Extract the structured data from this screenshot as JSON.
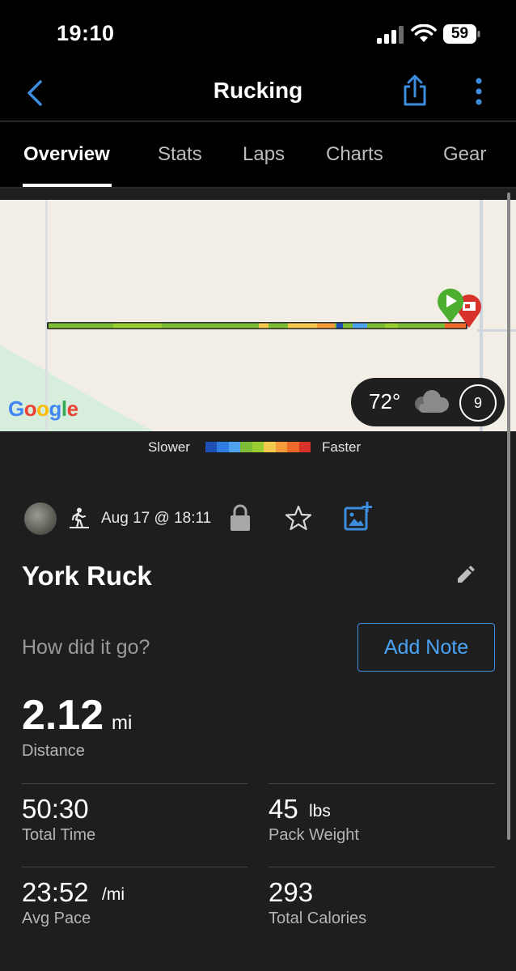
{
  "status_bar": {
    "time": "19:10",
    "battery": "59"
  },
  "nav": {
    "title": "Rucking"
  },
  "tabs": [
    {
      "label": "Overview"
    },
    {
      "label": "Stats"
    },
    {
      "label": "Laps"
    },
    {
      "label": "Charts"
    },
    {
      "label": "Gear"
    }
  ],
  "map": {
    "attribution": "Google",
    "weather": {
      "temp": "72°",
      "wind": "9"
    }
  },
  "legend": {
    "slower": "Slower",
    "faster": "Faster",
    "colors": [
      "#1e4fb5",
      "#2f7de0",
      "#4fa3ee",
      "#7dbd35",
      "#9acd32",
      "#f2c94c",
      "#f59b3a",
      "#ee6a2a",
      "#d9322a"
    ]
  },
  "activity": {
    "date": "Aug 17 @ 18:11",
    "name": "York Ruck",
    "prompt": "How did it go?",
    "add_note": "Add Note"
  },
  "stats": {
    "distance": {
      "value": "2.12",
      "unit": "mi",
      "label": "Distance"
    },
    "total_time": {
      "value": "50:30",
      "label": "Total Time"
    },
    "pack_weight": {
      "value": "45",
      "unit": "lbs",
      "label": "Pack Weight"
    },
    "avg_pace": {
      "value": "23:52",
      "unit": "/mi",
      "label": "Avg Pace"
    },
    "calories": {
      "value": "293",
      "label": "Total Calories"
    }
  },
  "colors": {
    "accent": "#3c8dde",
    "background": "#1e1e1e",
    "bar": "#000000"
  }
}
